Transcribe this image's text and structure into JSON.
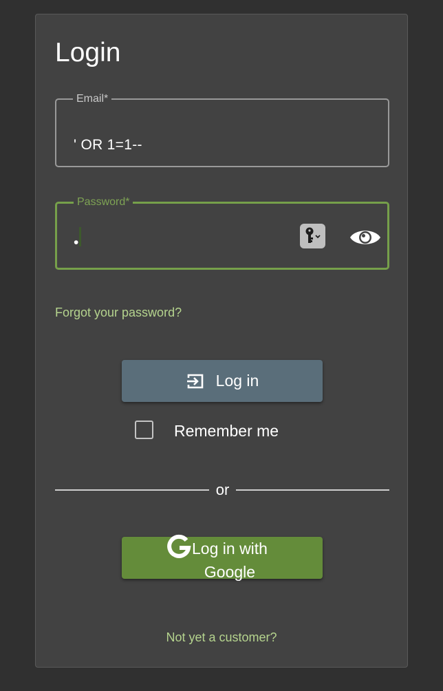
{
  "login_form": {
    "title": "Login",
    "email": {
      "label": "Email*",
      "value": "' OR 1=1--"
    },
    "password": {
      "label": "Password*",
      "value": "•"
    },
    "forgot_password_link": "Forgot your password?",
    "login_button": "Log in",
    "remember_me": {
      "label": "Remember me",
      "checked": false
    },
    "divider_text": "or",
    "google_button": "Log in with Google",
    "signup_link": "Not yet a customer?"
  },
  "colors": {
    "page_background": "#303030",
    "card_background": "#424242",
    "accent_green": "#76a04a",
    "link_green": "#b5d48e",
    "login_button": "#5a6e7a",
    "google_button": "#648c3a"
  },
  "icons": {
    "login_button_icon": "login-icon",
    "password_manager_icon": "key-icon",
    "show_password_icon": "eye-icon",
    "google_icon": "google-g-icon"
  }
}
